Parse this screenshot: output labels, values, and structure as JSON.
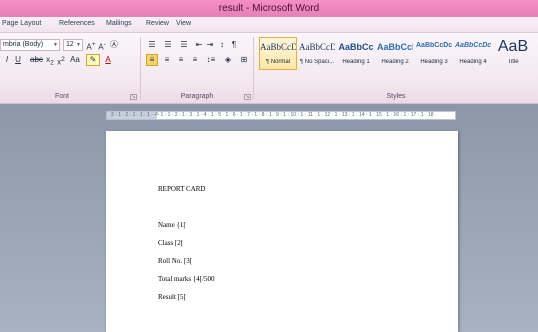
{
  "window": {
    "title": "result - Microsoft Word"
  },
  "tabs": [
    "Page Layout",
    "References",
    "Mailings",
    "Review",
    "View"
  ],
  "font_group": {
    "font_name": "mbria (Body)",
    "font_size": "12",
    "label": "Font"
  },
  "paragraph_group": {
    "label": "Paragraph"
  },
  "styles_group": {
    "label": "Styles",
    "styles": [
      {
        "preview": "AaBbCcD",
        "name": "¶ Normal",
        "selected": true
      },
      {
        "preview": "AaBbCcD",
        "name": "¶ No Spaci...",
        "selected": false
      },
      {
        "preview": "AaBbCc",
        "name": "Heading 1",
        "selected": false
      },
      {
        "preview": "AaBbCcI",
        "name": "Heading 2",
        "selected": false
      },
      {
        "preview": "AaBbCcDc",
        "name": "Heading 3",
        "selected": false
      },
      {
        "preview": "AaBbCcDc",
        "name": "Heading 4",
        "selected": false
      },
      {
        "preview": "AaB",
        "name": "Title",
        "selected": false
      }
    ]
  },
  "ruler": {
    "text": "3 · 1 · 2 · 1 · 1 · 1 · · · 1 · 1 · 2 · 1 · 3 · 1 · 4 · 1 · 5 · 1 · 6 · 1 · 7 · 1 · 8 · 1 · 9 · 1 · 10 · 1 · 11 · 1 · 12 · 1 · 13 · 1 · 14 · 1 · 15 · 1 · 16 · 1 · 17 · 1 · 18 ·"
  },
  "document": {
    "heading": "REPORT CARD",
    "lines": [
      "Name {1[",
      "Class [2[",
      "Roll No. [3[",
      "Total marks {4[/500",
      "Result [5["
    ]
  }
}
